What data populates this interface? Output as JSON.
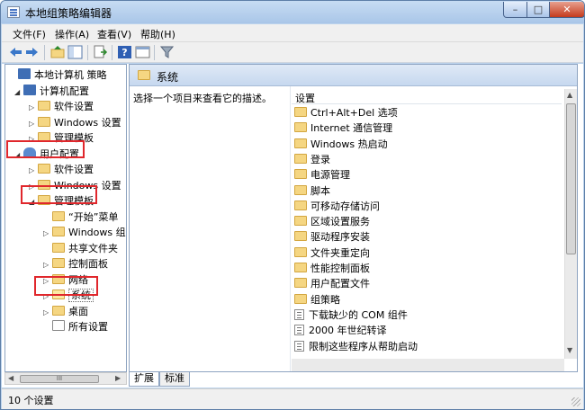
{
  "window": {
    "title": "本地组策略编辑器",
    "min": "–",
    "max": "□",
    "close": "✕"
  },
  "menu": [
    "文件(F)",
    "操作(A)",
    "查看(V)",
    "帮助(H)"
  ],
  "toolbar_icons": [
    "back-icon",
    "forward-icon",
    "up-folder-icon",
    "show-hide-tree-icon",
    "export-list-icon",
    "help-icon",
    "properties-icon",
    "filter-icon"
  ],
  "tree": [
    {
      "label": "本地计算机 策略",
      "icon": "computer-icon",
      "level": 0,
      "expander": "",
      "name": "tree-local-policy"
    },
    {
      "label": "计算机配置",
      "icon": "computer-icon",
      "level": 1,
      "expander": "◢",
      "name": "tree-computer-config"
    },
    {
      "label": "软件设置",
      "icon": "folder-icon",
      "level": 2,
      "expander": "▷",
      "name": "tree-software-settings-1"
    },
    {
      "label": "Windows 设置",
      "icon": "folder-icon",
      "level": 2,
      "expander": "▷",
      "name": "tree-windows-settings-1"
    },
    {
      "label": "管理模板",
      "icon": "folder-icon",
      "level": 2,
      "expander": "▷",
      "name": "tree-admin-templates-1"
    },
    {
      "label": "用户配置",
      "icon": "user-icon",
      "level": 1,
      "expander": "◢",
      "name": "tree-user-config"
    },
    {
      "label": "软件设置",
      "icon": "folder-icon",
      "level": 2,
      "expander": "▷",
      "name": "tree-software-settings-2"
    },
    {
      "label": "Windows 设置",
      "icon": "folder-icon",
      "level": 2,
      "expander": "▷",
      "name": "tree-windows-settings-2"
    },
    {
      "label": "管理模板",
      "icon": "folder-icon",
      "level": 2,
      "expander": "◢",
      "name": "tree-admin-templates-2"
    },
    {
      "label": "“开始”菜单",
      "icon": "folder-icon",
      "level": 3,
      "expander": "",
      "name": "tree-start-menu"
    },
    {
      "label": "Windows 组",
      "icon": "folder-icon",
      "level": 3,
      "expander": "▷",
      "name": "tree-windows-components"
    },
    {
      "label": "共享文件夹",
      "icon": "folder-icon",
      "level": 3,
      "expander": "",
      "name": "tree-shared-folders"
    },
    {
      "label": "控制面板",
      "icon": "folder-icon",
      "level": 3,
      "expander": "▷",
      "name": "tree-control-panel"
    },
    {
      "label": "网络",
      "icon": "folder-icon",
      "level": 3,
      "expander": "▷",
      "name": "tree-network"
    },
    {
      "label": "系统",
      "icon": "folder-icon",
      "level": 3,
      "expander": "▷",
      "name": "tree-system",
      "selected": true
    },
    {
      "label": "桌面",
      "icon": "folder-icon",
      "level": 3,
      "expander": "▷",
      "name": "tree-desktop"
    },
    {
      "label": "所有设置",
      "icon": "settings-icon",
      "level": 3,
      "expander": "",
      "name": "tree-all-settings"
    }
  ],
  "tree_scroll_thumb": "III",
  "header": {
    "title": "系统"
  },
  "description": "选择一个项目来查看它的描述。",
  "list_header": "设置",
  "items": [
    {
      "label": "Ctrl+Alt+Del 选项",
      "icon": "folder"
    },
    {
      "label": "Internet 通信管理",
      "icon": "folder"
    },
    {
      "label": "Windows 热启动",
      "icon": "folder"
    },
    {
      "label": "登录",
      "icon": "folder"
    },
    {
      "label": "电源管理",
      "icon": "folder"
    },
    {
      "label": "脚本",
      "icon": "folder"
    },
    {
      "label": "可移动存储访问",
      "icon": "folder"
    },
    {
      "label": "区域设置服务",
      "icon": "folder"
    },
    {
      "label": "驱动程序安装",
      "icon": "folder"
    },
    {
      "label": "文件夹重定向",
      "icon": "folder"
    },
    {
      "label": "性能控制面板",
      "icon": "folder"
    },
    {
      "label": "用户配置文件",
      "icon": "folder"
    },
    {
      "label": "组策略",
      "icon": "folder"
    },
    {
      "label": "下载缺少的 COM 组件",
      "icon": "policy"
    },
    {
      "label": "2000 年世纪转译",
      "icon": "policy"
    },
    {
      "label": "限制这些程序从帮助启动",
      "icon": "policy"
    }
  ],
  "tabs": [
    "扩展",
    "标准"
  ],
  "status": "10 个设置",
  "colors": {
    "highlight_box": "#e0272c",
    "folder": "#f5d682",
    "header_band": "#c6d8ef"
  }
}
